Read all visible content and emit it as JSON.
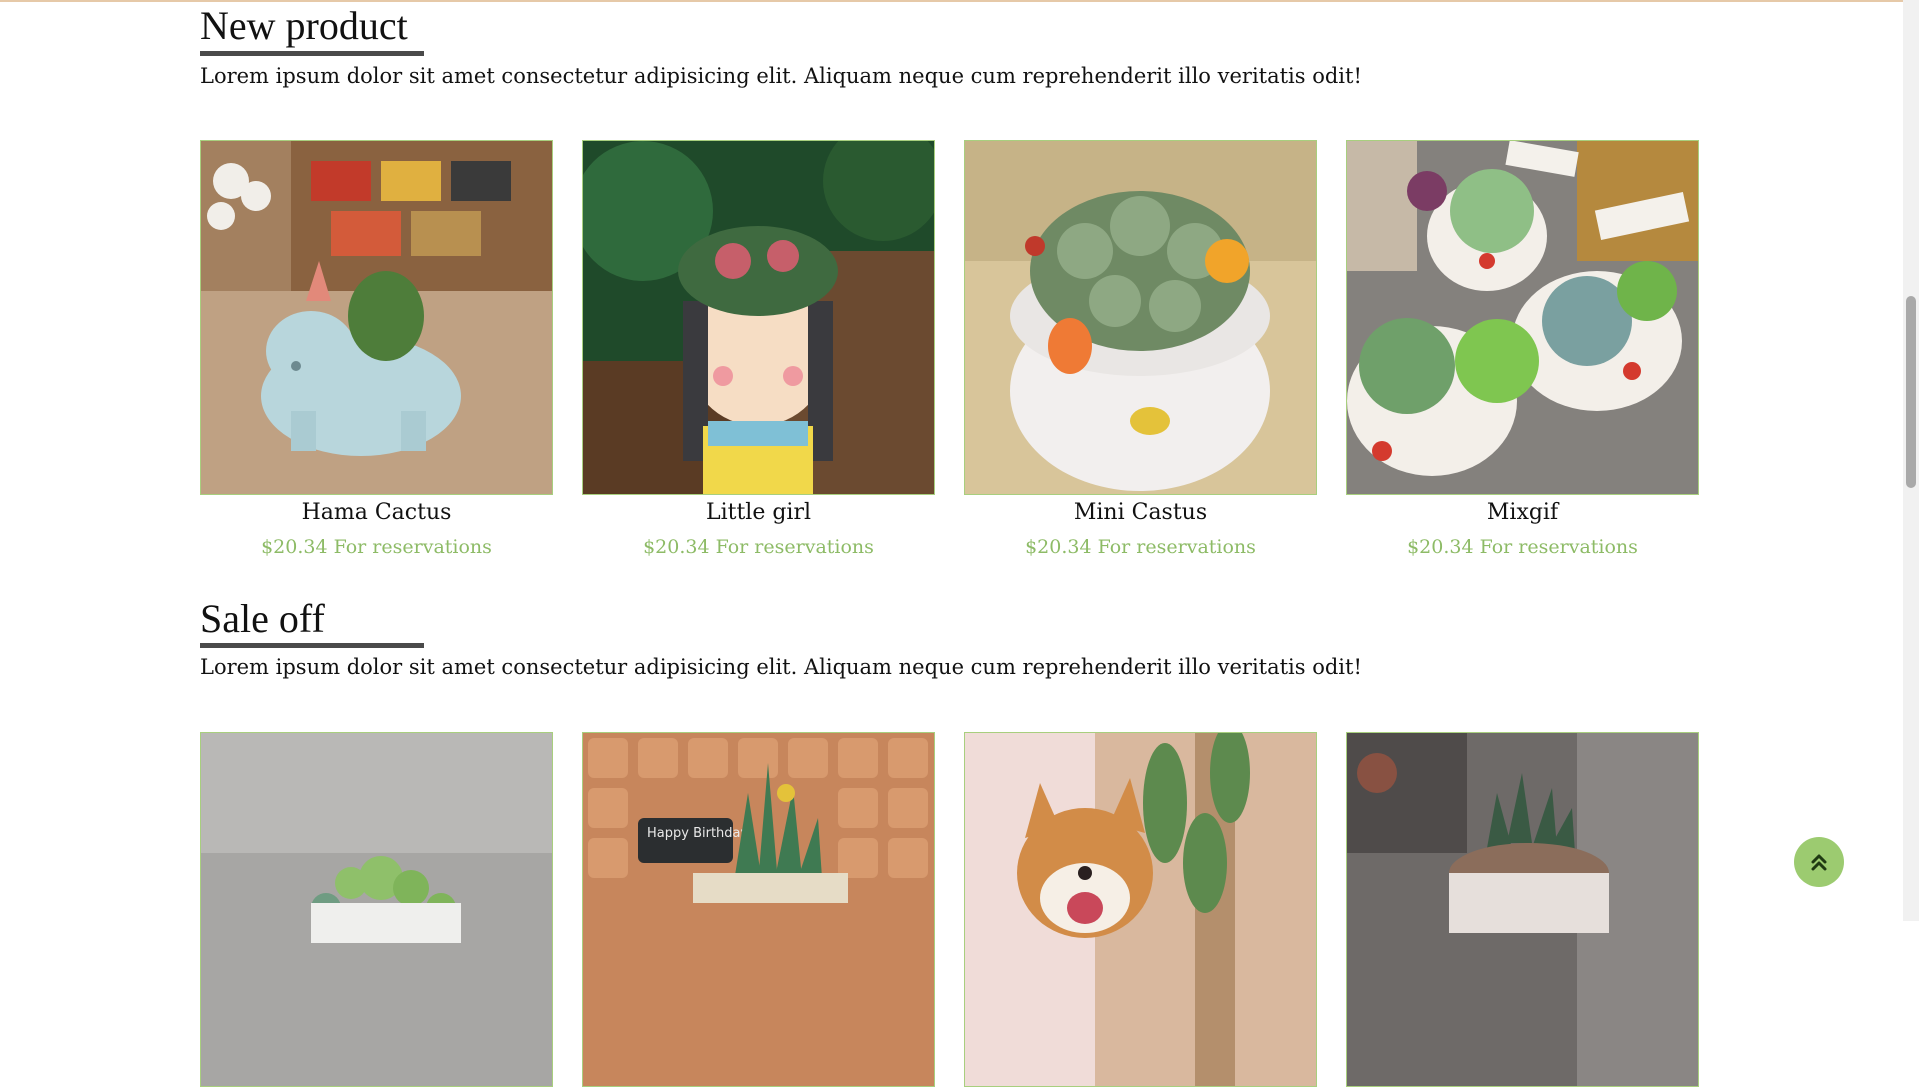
{
  "new_product": {
    "title": "New product",
    "description": "Lorem ipsum dolor sit amet consectetur adipisicing elit. Aliquam neque cum reprehenderit illo veritatis odit!",
    "items": [
      {
        "name": "Hama Cactus",
        "price": "$20.34 For reservations"
      },
      {
        "name": "Little girl",
        "price": "$20.34 For reservations"
      },
      {
        "name": "Mini Castus",
        "price": "$20.34 For reservations"
      },
      {
        "name": "Mixgif",
        "price": "$20.34 For reservations"
      }
    ]
  },
  "sale_off": {
    "title": "Sale off",
    "description": "Lorem ipsum dolor sit amet consectetur adipisicing elit. Aliquam neque cum reprehenderit illo veritatis odit!",
    "image_texts": {
      "birthday_sign": "Happy Birthday"
    }
  },
  "back_to_top": {
    "icon": "double-chevron-up-icon"
  },
  "colors": {
    "accent_green": "#8dbb66",
    "card_border": "#a8cf7e",
    "button_bg": "#9ccb70",
    "underline": "#4a4a4a"
  }
}
